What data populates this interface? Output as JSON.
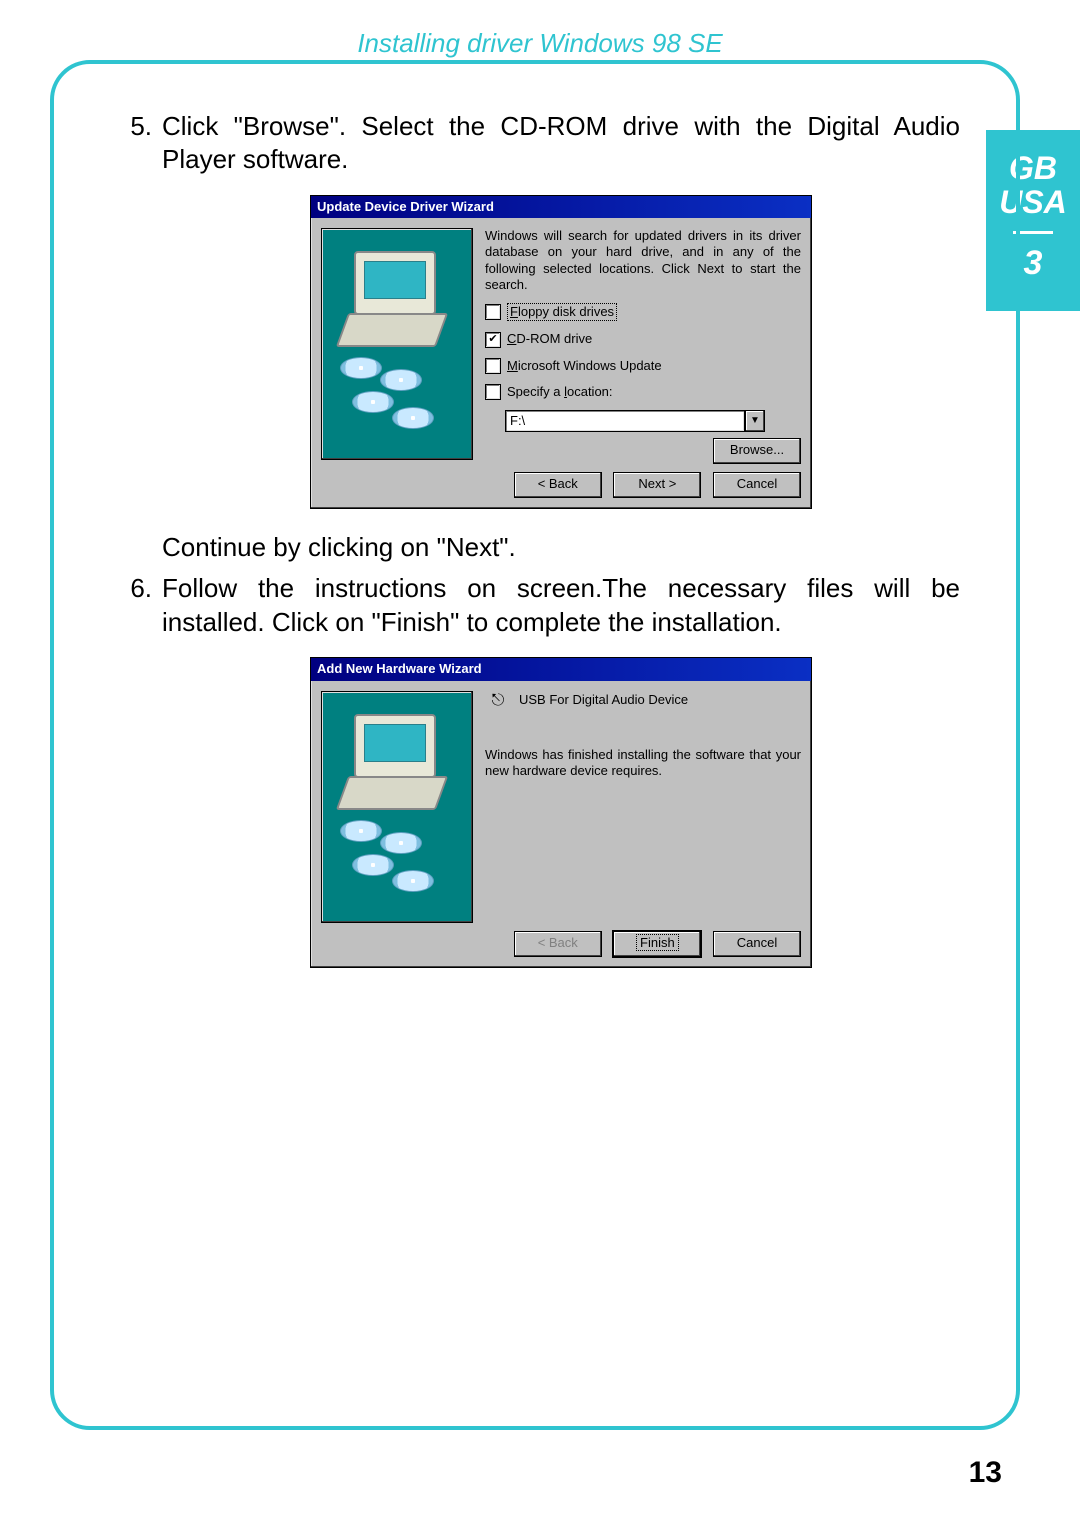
{
  "header": {
    "running_title": "Installing driver Windows 98 SE"
  },
  "tab": {
    "region1": "GB",
    "region2": "USA",
    "chapter": "3"
  },
  "steps": {
    "s5": {
      "num": "5.",
      "text": "Click \"Browse\". Select the CD-ROM drive with the Digital Audio Player software.",
      "continue": "Continue by clicking on \"Next\"."
    },
    "s6": {
      "num": "6.",
      "text": "Follow the instructions on screen.The necessary files will be installed. Click on \"Finish\" to complete the installation."
    }
  },
  "dialog1": {
    "title": "Update Device Driver Wizard",
    "intro": "Windows will search for updated drivers in its driver database on your hard drive, and in any of the following selected locations. Click Next to start the search.",
    "chk_floppy": "Floppy disk drives",
    "chk_cdrom": "CD-ROM drive",
    "chk_winupdate": "Microsoft Windows Update",
    "chk_specify": "Specify a location:",
    "location_value": "F:\\",
    "browse": "Browse...",
    "back": "< Back",
    "next": "Next >",
    "cancel": "Cancel"
  },
  "dialog2": {
    "title": "Add New Hardware Wizard",
    "device": "USB For Digital Audio Device",
    "done": "Windows has finished installing the software that your new hardware device requires.",
    "back": "< Back",
    "finish": "Finish",
    "cancel": "Cancel"
  },
  "page_number": "13"
}
